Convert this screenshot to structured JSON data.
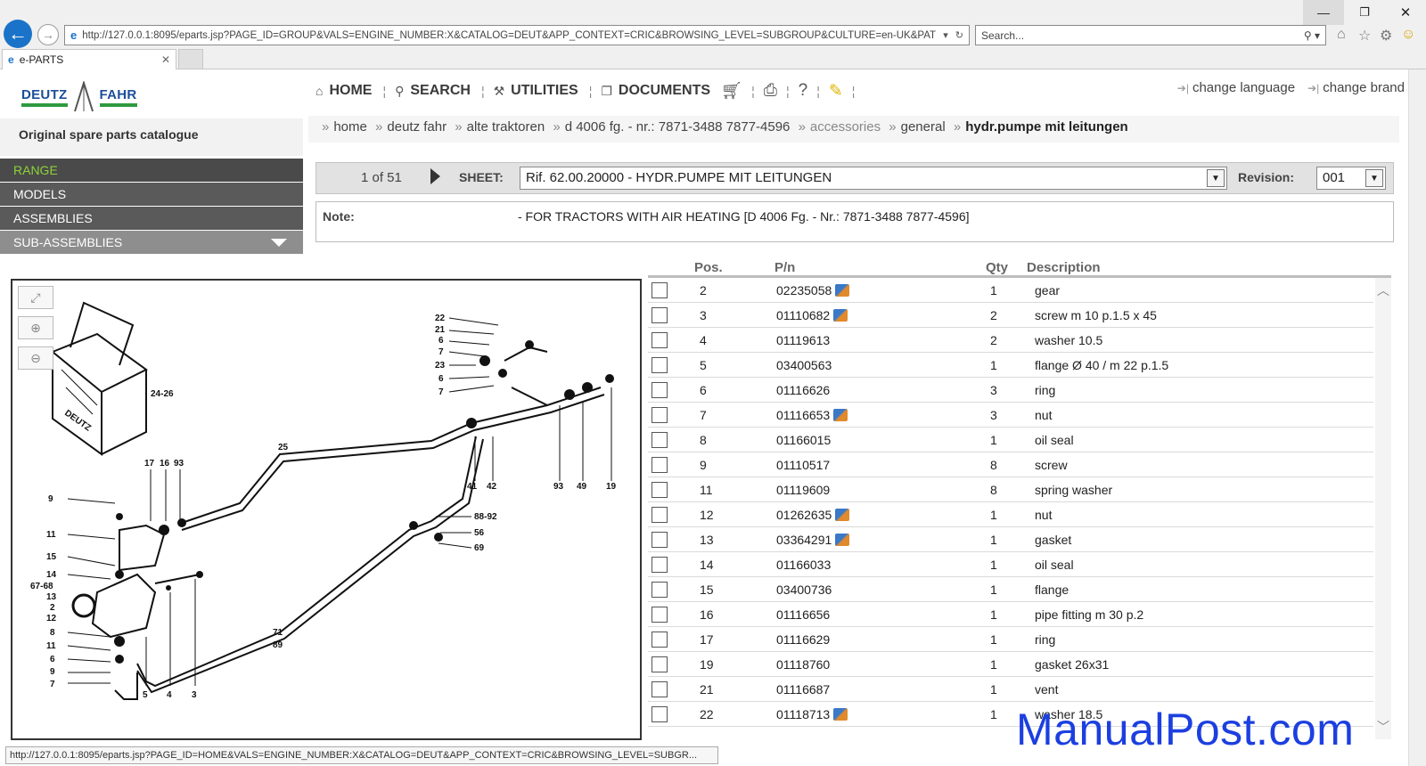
{
  "browser": {
    "address": "http://127.0.0.1:8095/eparts.jsp?PAGE_ID=GROUP&VALS=ENGINE_NUMBER:X&CATALOG=DEUT&APP_CONTEXT=CRIC&BROWSING_LEVEL=SUBGROUP&CULTURE=en-UK&PATH=",
    "search_placeholder": "Search...",
    "tab_label": "e-PARTS",
    "status_url": "http://127.0.0.1:8095/eparts.jsp?PAGE_ID=HOME&VALS=ENGINE_NUMBER:X&CATALOG=DEUT&APP_CONTEXT=CRIC&BROWSING_LEVEL=SUBGR..."
  },
  "brand": {
    "left": "DEUTZ",
    "right": "FAHR"
  },
  "catalogue_title": "Original spare parts catalogue",
  "leftnav": {
    "range": "RANGE",
    "models": "MODELS",
    "assemblies": "ASSEMBLIES",
    "subassemblies": "SUB-ASSEMBLIES"
  },
  "menu": {
    "home": "HOME",
    "search": "SEARCH",
    "utilities": "UTILITIES",
    "documents": "DOCUMENTS"
  },
  "links": {
    "change_language": "change language",
    "change_brand": "change brand"
  },
  "breadcrumb": {
    "home": "home",
    "brand": "deutz fahr",
    "series": "alte traktoren",
    "model": "d 4006 fg. - nr.: 7871-3488 7877-4596",
    "group": "accessories",
    "subgroup": "general",
    "current": "hydr.pumpe mit leitungen"
  },
  "sheet": {
    "pager": "1 of 51",
    "label": "SHEET:",
    "value": "Rif. 62.00.20000 - HYDR.PUMPE MIT LEITUNGEN",
    "revision_label": "Revision:",
    "revision_value": "001"
  },
  "note": {
    "label": "Note:",
    "text": "- FOR TRACTORS WITH AIR HEATING [D 4006 Fg. - Nr.: 7871-3488 7877-4596]"
  },
  "table": {
    "headers": {
      "pos": "Pos.",
      "pn": "P/n",
      "qty": "Qty",
      "desc": "Description"
    },
    "rows": [
      {
        "pos": "2",
        "pn": "02235058",
        "qty": "1",
        "desc": "gear",
        "cart": true
      },
      {
        "pos": "3",
        "pn": "01110682",
        "qty": "2",
        "desc": "screw m 10 p.1.5 x 45",
        "cart": true
      },
      {
        "pos": "4",
        "pn": "01119613",
        "qty": "2",
        "desc": "washer 10.5",
        "cart": false
      },
      {
        "pos": "5",
        "pn": "03400563",
        "qty": "1",
        "desc": "flange Ø 40 / m 22 p.1.5",
        "cart": false
      },
      {
        "pos": "6",
        "pn": "01116626",
        "qty": "3",
        "desc": "ring",
        "cart": false
      },
      {
        "pos": "7",
        "pn": "01116653",
        "qty": "3",
        "desc": "nut",
        "cart": true
      },
      {
        "pos": "8",
        "pn": "01166015",
        "qty": "1",
        "desc": "oil seal",
        "cart": false
      },
      {
        "pos": "9",
        "pn": "01110517",
        "qty": "8",
        "desc": "screw",
        "cart": false
      },
      {
        "pos": "11",
        "pn": "01119609",
        "qty": "8",
        "desc": "spring washer",
        "cart": false
      },
      {
        "pos": "12",
        "pn": "01262635",
        "qty": "1",
        "desc": "nut",
        "cart": true
      },
      {
        "pos": "13",
        "pn": "03364291",
        "qty": "1",
        "desc": "gasket",
        "cart": true
      },
      {
        "pos": "14",
        "pn": "01166033",
        "qty": "1",
        "desc": "oil seal",
        "cart": false
      },
      {
        "pos": "15",
        "pn": "03400736",
        "qty": "1",
        "desc": "flange",
        "cart": false
      },
      {
        "pos": "16",
        "pn": "01116656",
        "qty": "1",
        "desc": "pipe fitting m 30 p.2",
        "cart": false
      },
      {
        "pos": "17",
        "pn": "01116629",
        "qty": "1",
        "desc": "ring",
        "cart": false
      },
      {
        "pos": "19",
        "pn": "01118760",
        "qty": "1",
        "desc": "gasket 26x31",
        "cart": false
      },
      {
        "pos": "21",
        "pn": "01116687",
        "qty": "1",
        "desc": "vent",
        "cart": false
      },
      {
        "pos": "22",
        "pn": "01118713",
        "qty": "1",
        "desc": "washer 18.5",
        "cart": true
      }
    ]
  },
  "drawing": {
    "box_label": "24-26",
    "box_brand": "DEUTZ",
    "callouts": [
      "22",
      "21",
      "6",
      "7",
      "23",
      "6",
      "7",
      "25",
      "41",
      "42",
      "93",
      "49",
      "19",
      "17",
      "16",
      "93",
      "9",
      "11",
      "15",
      "14",
      "67-68",
      "13",
      "2",
      "12",
      "8",
      "11",
      "6",
      "9",
      "7",
      "5",
      "4",
      "3",
      "88-92",
      "56",
      "69",
      "71",
      "89"
    ]
  },
  "watermark": "ManualPost.com"
}
